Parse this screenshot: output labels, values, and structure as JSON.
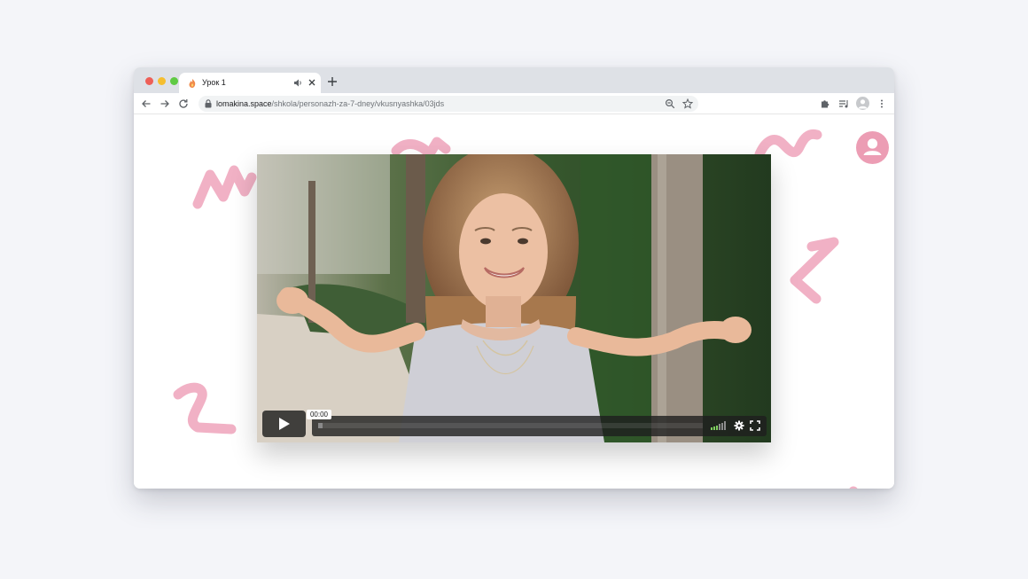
{
  "browser": {
    "tab": {
      "title": "Урок 1",
      "favicon": "flame-favicon-icon",
      "audio_icon": "speaker-icon",
      "close_icon": "close-icon"
    },
    "new_tab_icon": "plus-icon",
    "toolbar": {
      "back_icon": "back-arrow-icon",
      "forward_icon": "forward-arrow-icon",
      "reload_icon": "reload-icon",
      "lock_icon": "lock-icon",
      "url_host": "lomakina.space",
      "url_path": "/shkola/personazh-za-7-dney/vkusnyashka/03jds",
      "zoom_icon": "zoom-icon",
      "bookmark_icon": "star-icon",
      "extensions_icon": "puzzle-icon",
      "media_icon": "media-queue-icon",
      "profile_icon": "profile-avatar-icon",
      "menu_icon": "kebab-menu-icon"
    }
  },
  "page": {
    "account_icon": "user-avatar-icon",
    "accent_color": "#ec9db4",
    "video": {
      "current_time": "00:00",
      "progress": 0.0,
      "volume_level": 0.6,
      "icons": [
        "play-icon",
        "volume-icon",
        "settings-icon",
        "fullscreen-icon"
      ]
    }
  }
}
